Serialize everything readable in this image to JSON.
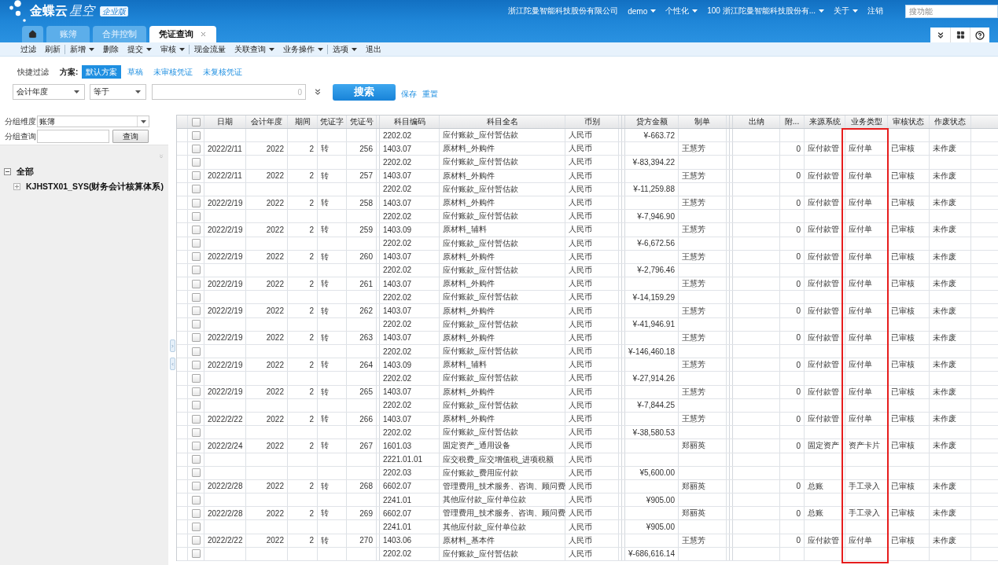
{
  "header": {
    "logo": {
      "brand": "金蝶云",
      "product": "星空",
      "edition": "企业版"
    },
    "company": "浙江陀曼智能科技股份有限公司",
    "menus": [
      {
        "label": "demo",
        "dropdown": true
      },
      {
        "label": "个性化",
        "dropdown": true
      },
      {
        "label": "100 浙江陀曼智能科技股份有...",
        "dropdown": true
      },
      {
        "label": "关于",
        "dropdown": true
      },
      {
        "label": "注销",
        "dropdown": false
      }
    ],
    "search": {
      "placeholder": "搜功能"
    }
  },
  "tabs": [
    {
      "kind": "home",
      "selected": false,
      "closable": false
    },
    {
      "kind": "text",
      "label": "账簿",
      "selected": false,
      "closable": false
    },
    {
      "kind": "text",
      "label": "合并控制",
      "selected": false,
      "closable": false
    },
    {
      "kind": "text",
      "label": "凭证查询",
      "selected": true,
      "closable": true
    }
  ],
  "toolbar": {
    "groups": [
      {
        "items": [
          {
            "label": "过滤",
            "dropdown": false
          },
          {
            "label": "刷新",
            "dropdown": false
          }
        ]
      },
      {
        "items": [
          {
            "label": "新增",
            "dropdown": true
          },
          {
            "label": "删除",
            "dropdown": false
          },
          {
            "label": "提交",
            "dropdown": true
          },
          {
            "label": "审核",
            "dropdown": true
          }
        ]
      },
      {
        "items": [
          {
            "label": "现金流量",
            "dropdown": false
          },
          {
            "label": "关联查询",
            "dropdown": true
          },
          {
            "label": "业务操作",
            "dropdown": true
          }
        ]
      },
      {
        "items": [
          {
            "label": "选项",
            "dropdown": true
          },
          {
            "label": "退出",
            "dropdown": false
          }
        ]
      }
    ]
  },
  "quick_filter": {
    "label": "快捷过滤",
    "scheme_label": "方案:",
    "schemes": [
      {
        "label": "默认方案",
        "selected": true
      },
      {
        "label": "草稿",
        "selected": false
      },
      {
        "label": "未审核凭证",
        "selected": false
      },
      {
        "label": "未复核凭证",
        "selected": false
      }
    ]
  },
  "filter": {
    "field": "会计年度",
    "operator": "等于",
    "counter": "0",
    "search_button": "搜索",
    "links": [
      "保存",
      "重置"
    ]
  },
  "left_panel": {
    "group_dimension": {
      "label": "分组维度",
      "value": "账簿"
    },
    "group_query": {
      "label": "分组查询",
      "button": "查询"
    },
    "tree": [
      {
        "label": "全部",
        "expanded": true,
        "children": [
          {
            "label": "KJHSTX01_SYS(财务会计核算体系)",
            "expanded": false
          }
        ]
      }
    ]
  },
  "table": {
    "select_all": {
      "checked": false
    },
    "columns": [
      {
        "label": "日期"
      },
      {
        "label": "会计年度"
      },
      {
        "label": "期间"
      },
      {
        "label": "凭证字"
      },
      {
        "label": "凭证号"
      },
      {
        "label": "科目编码"
      },
      {
        "label": "科目全名"
      },
      {
        "label": "币别"
      },
      {
        "label": "贷方金额"
      },
      {
        "label": "制单"
      },
      {
        "label": "出纳"
      },
      {
        "label": "附..."
      },
      {
        "label": "来源系统"
      },
      {
        "label": "业务类型"
      },
      {
        "label": "审核状态"
      },
      {
        "label": "作废状态"
      }
    ],
    "rows": [
      {
        "checked": false,
        "account_code": "2202.02",
        "account_name": "应付账款_应付暂估款",
        "currency": "人民币",
        "credit_amount": "¥-663.72"
      },
      {
        "checked": false,
        "date": "2022/2/11",
        "year": "2022",
        "period": "2",
        "voucher_word": "转",
        "voucher_no": "256",
        "account_code": "1403.07",
        "account_name": "原材料_外购件",
        "currency": "人民币",
        "maker": "王慧芳",
        "attachments": "0",
        "source_system": "应付款管",
        "business_type": "应付单",
        "audit_status": "已审核",
        "void_status": "未作废"
      },
      {
        "checked": false,
        "account_code": "2202.02",
        "account_name": "应付账款_应付暂估款",
        "currency": "人民币",
        "credit_amount": "¥-83,394.22"
      },
      {
        "checked": false,
        "date": "2022/2/11",
        "year": "2022",
        "period": "2",
        "voucher_word": "转",
        "voucher_no": "257",
        "account_code": "1403.07",
        "account_name": "原材料_外购件",
        "currency": "人民币",
        "maker": "王慧芳",
        "attachments": "0",
        "source_system": "应付款管",
        "business_type": "应付单",
        "audit_status": "已审核",
        "void_status": "未作废"
      },
      {
        "checked": false,
        "account_code": "2202.02",
        "account_name": "应付账款_应付暂估款",
        "currency": "人民币",
        "credit_amount": "¥-11,259.88"
      },
      {
        "checked": false,
        "date": "2022/2/19",
        "year": "2022",
        "period": "2",
        "voucher_word": "转",
        "voucher_no": "258",
        "account_code": "1403.07",
        "account_name": "原材料_外购件",
        "currency": "人民币",
        "maker": "王慧芳",
        "attachments": "0",
        "source_system": "应付款管",
        "business_type": "应付单",
        "audit_status": "已审核",
        "void_status": "未作废"
      },
      {
        "checked": false,
        "account_code": "2202.02",
        "account_name": "应付账款_应付暂估款",
        "currency": "人民币",
        "credit_amount": "¥-7,946.90"
      },
      {
        "checked": false,
        "date": "2022/2/19",
        "year": "2022",
        "period": "2",
        "voucher_word": "转",
        "voucher_no": "259",
        "account_code": "1403.09",
        "account_name": "原材料_辅料",
        "currency": "人民币",
        "maker": "王慧芳",
        "attachments": "0",
        "source_system": "应付款管",
        "business_type": "应付单",
        "audit_status": "已审核",
        "void_status": "未作废"
      },
      {
        "checked": false,
        "account_code": "2202.02",
        "account_name": "应付账款_应付暂估款",
        "currency": "人民币",
        "credit_amount": "¥-6,672.56"
      },
      {
        "checked": false,
        "date": "2022/2/19",
        "year": "2022",
        "period": "2",
        "voucher_word": "转",
        "voucher_no": "260",
        "account_code": "1403.07",
        "account_name": "原材料_外购件",
        "currency": "人民币",
        "maker": "王慧芳",
        "attachments": "0",
        "source_system": "应付款管",
        "business_type": "应付单",
        "audit_status": "已审核",
        "void_status": "未作废"
      },
      {
        "checked": false,
        "account_code": "2202.02",
        "account_name": "应付账款_应付暂估款",
        "currency": "人民币",
        "credit_amount": "¥-2,796.46"
      },
      {
        "checked": false,
        "date": "2022/2/19",
        "year": "2022",
        "period": "2",
        "voucher_word": "转",
        "voucher_no": "261",
        "account_code": "1403.07",
        "account_name": "原材料_外购件",
        "currency": "人民币",
        "maker": "王慧芳",
        "attachments": "0",
        "source_system": "应付款管",
        "business_type": "应付单",
        "audit_status": "已审核",
        "void_status": "未作废"
      },
      {
        "checked": false,
        "account_code": "2202.02",
        "account_name": "应付账款_应付暂估款",
        "currency": "人民币",
        "credit_amount": "¥-14,159.29"
      },
      {
        "checked": false,
        "date": "2022/2/19",
        "year": "2022",
        "period": "2",
        "voucher_word": "转",
        "voucher_no": "262",
        "account_code": "1403.07",
        "account_name": "原材料_外购件",
        "currency": "人民币",
        "maker": "王慧芳",
        "attachments": "0",
        "source_system": "应付款管",
        "business_type": "应付单",
        "audit_status": "已审核",
        "void_status": "未作废"
      },
      {
        "checked": false,
        "account_code": "2202.02",
        "account_name": "应付账款_应付暂估款",
        "currency": "人民币",
        "credit_amount": "¥-41,946.91"
      },
      {
        "checked": false,
        "date": "2022/2/19",
        "year": "2022",
        "period": "2",
        "voucher_word": "转",
        "voucher_no": "263",
        "account_code": "1403.07",
        "account_name": "原材料_外购件",
        "currency": "人民币",
        "maker": "王慧芳",
        "attachments": "0",
        "source_system": "应付款管",
        "business_type": "应付单",
        "audit_status": "已审核",
        "void_status": "未作废"
      },
      {
        "checked": false,
        "account_code": "2202.02",
        "account_name": "应付账款_应付暂估款",
        "currency": "人民币",
        "credit_amount": "¥-146,460.18"
      },
      {
        "checked": false,
        "date": "2022/2/19",
        "year": "2022",
        "period": "2",
        "voucher_word": "转",
        "voucher_no": "264",
        "account_code": "1403.09",
        "account_name": "原材料_辅料",
        "currency": "人民币",
        "maker": "王慧芳",
        "attachments": "0",
        "source_system": "应付款管",
        "business_type": "应付单",
        "audit_status": "已审核",
        "void_status": "未作废"
      },
      {
        "checked": false,
        "account_code": "2202.02",
        "account_name": "应付账款_应付暂估款",
        "currency": "人民币",
        "credit_amount": "¥-27,914.26"
      },
      {
        "checked": false,
        "date": "2022/2/19",
        "year": "2022",
        "period": "2",
        "voucher_word": "转",
        "voucher_no": "265",
        "account_code": "1403.07",
        "account_name": "原材料_外购件",
        "currency": "人民币",
        "maker": "王慧芳",
        "attachments": "0",
        "source_system": "应付款管",
        "business_type": "应付单",
        "audit_status": "已审核",
        "void_status": "未作废"
      },
      {
        "checked": false,
        "account_code": "2202.02",
        "account_name": "应付账款_应付暂估款",
        "currency": "人民币",
        "credit_amount": "¥-7,844.25"
      },
      {
        "checked": false,
        "date": "2022/2/22",
        "year": "2022",
        "period": "2",
        "voucher_word": "转",
        "voucher_no": "266",
        "account_code": "1403.07",
        "account_name": "原材料_外购件",
        "currency": "人民币",
        "maker": "王慧芳",
        "attachments": "0",
        "source_system": "应付款管",
        "business_type": "应付单",
        "audit_status": "已审核",
        "void_status": "未作废"
      },
      {
        "checked": false,
        "account_code": "2202.02",
        "account_name": "应付账款_应付暂估款",
        "currency": "人民币",
        "credit_amount": "¥-38,580.53"
      },
      {
        "checked": false,
        "date": "2022/2/24",
        "year": "2022",
        "period": "2",
        "voucher_word": "转",
        "voucher_no": "267",
        "account_code": "1601.03",
        "account_name": "固定资产_通用设备",
        "currency": "人民币",
        "maker": "郑丽英",
        "attachments": "0",
        "source_system": "固定资产",
        "business_type": "资产卡片",
        "audit_status": "已审核",
        "void_status": "未作废"
      },
      {
        "checked": false,
        "account_code": "2221.01.01",
        "account_name": "应交税费_应交增值税_进项税额",
        "currency": "人民币"
      },
      {
        "checked": false,
        "account_code": "2202.03",
        "account_name": "应付账款_费用应付款",
        "currency": "人民币",
        "credit_amount": "¥5,600.00"
      },
      {
        "checked": false,
        "date": "2022/2/28",
        "year": "2022",
        "period": "2",
        "voucher_word": "转",
        "voucher_no": "268",
        "account_code": "6602.07",
        "account_name": "管理费用_技术服务、咨询、顾问费",
        "currency": "人民币",
        "maker": "郑丽英",
        "attachments": "0",
        "source_system": "总账",
        "business_type": "手工录入",
        "audit_status": "已审核",
        "void_status": "未作废"
      },
      {
        "checked": false,
        "account_code": "2241.01",
        "account_name": "其他应付款_应付单位款",
        "currency": "人民币",
        "credit_amount": "¥905.00"
      },
      {
        "checked": false,
        "date": "2022/2/28",
        "year": "2022",
        "period": "2",
        "voucher_word": "转",
        "voucher_no": "269",
        "account_code": "6602.07",
        "account_name": "管理费用_技术服务、咨询、顾问费",
        "currency": "人民币",
        "maker": "郑丽英",
        "attachments": "0",
        "source_system": "总账",
        "business_type": "手工录入",
        "audit_status": "已审核",
        "void_status": "未作废"
      },
      {
        "checked": false,
        "account_code": "2241.01",
        "account_name": "其他应付款_应付单位款",
        "currency": "人民币",
        "credit_amount": "¥905.00"
      },
      {
        "checked": false,
        "date": "2022/2/22",
        "year": "2022",
        "period": "2",
        "voucher_word": "转",
        "voucher_no": "270",
        "account_code": "1403.06",
        "account_name": "原材料_基本件",
        "currency": "人民币",
        "maker": "王慧芳",
        "attachments": "0",
        "source_system": "应付款管",
        "business_type": "应付单",
        "audit_status": "已审核",
        "void_status": "未作废"
      },
      {
        "checked": false,
        "account_code": "2202.02",
        "account_name": "应付账款_应付暂估款",
        "currency": "人民币",
        "credit_amount": "¥-686,616.14"
      }
    ]
  },
  "annotation": {
    "kind": "outline"
  }
}
